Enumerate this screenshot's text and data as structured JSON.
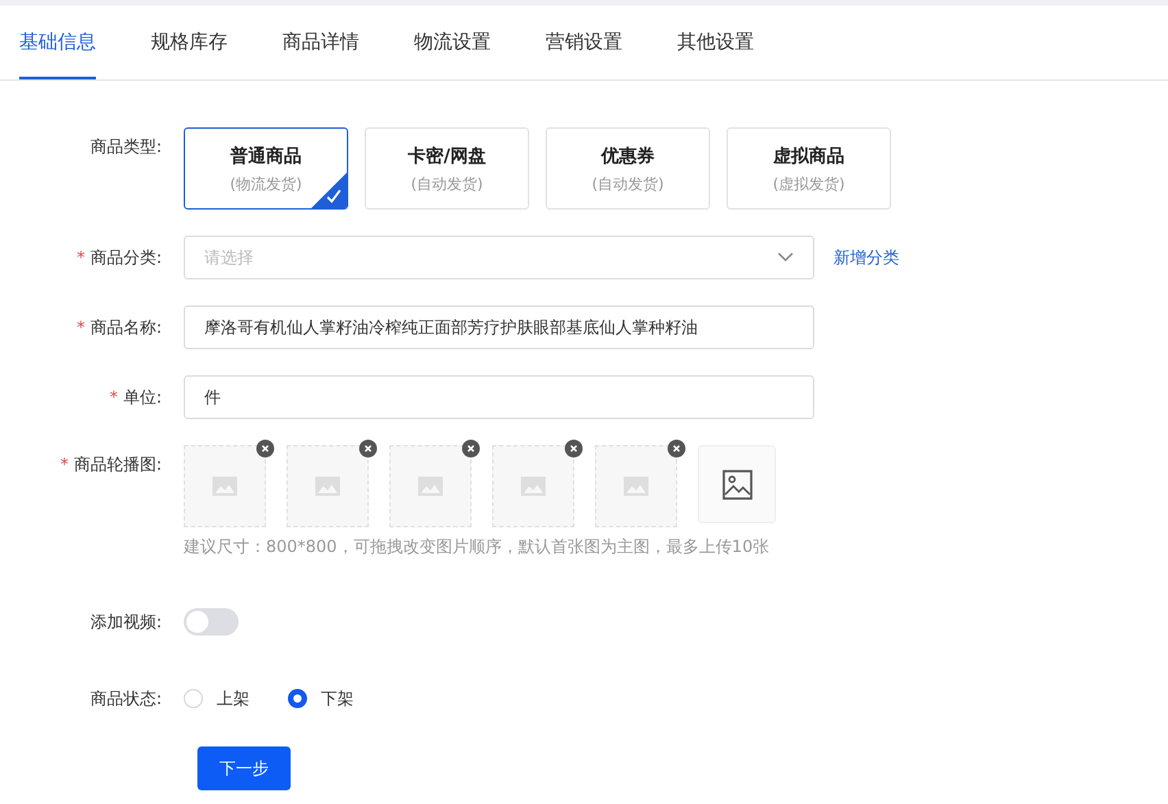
{
  "tabs": [
    {
      "label": "基础信息",
      "selected": true
    },
    {
      "label": "规格库存",
      "selected": false
    },
    {
      "label": "商品详情",
      "selected": false
    },
    {
      "label": "物流设置",
      "selected": false
    },
    {
      "label": "营销设置",
      "selected": false
    },
    {
      "label": "其他设置",
      "selected": false
    }
  ],
  "product_type": {
    "label": "商品类型:",
    "options": [
      {
        "title": "普通商品",
        "subtitle": "(物流发货)",
        "selected": true
      },
      {
        "title": "卡密/网盘",
        "subtitle": "(自动发货)",
        "selected": false
      },
      {
        "title": "优惠券",
        "subtitle": "(自动发货)",
        "selected": false
      },
      {
        "title": "虚拟商品",
        "subtitle": "(虚拟发货)",
        "selected": false
      }
    ]
  },
  "category": {
    "label": "商品分类:",
    "required_mark": "*",
    "placeholder": "请选择",
    "link": "新增分类"
  },
  "name": {
    "label": "商品名称:",
    "required_mark": "*",
    "value": "摩洛哥有机仙人掌籽油冷榨纯正面部芳疗护肤眼部基底仙人掌种籽油"
  },
  "unit": {
    "label": "单位:",
    "required_mark": "*",
    "value": "件"
  },
  "gallery": {
    "label": "商品轮播图:",
    "required_mark": "*",
    "images": [
      {
        "kind": "placeholder"
      },
      {
        "kind": "placeholder"
      },
      {
        "kind": "placeholder"
      },
      {
        "kind": "placeholder"
      },
      {
        "kind": "placeholder"
      },
      {
        "kind": "upload"
      }
    ],
    "hint": "建议尺寸：800*800，可拖拽改变图片顺序，默认首张图为主图，最多上传10张"
  },
  "video": {
    "label": "添加视频:",
    "on": false
  },
  "status": {
    "label": "商品状态:",
    "options": [
      {
        "label": "上架",
        "selected": false
      },
      {
        "label": "下架",
        "selected": true
      }
    ]
  },
  "next_button": "下一步"
}
